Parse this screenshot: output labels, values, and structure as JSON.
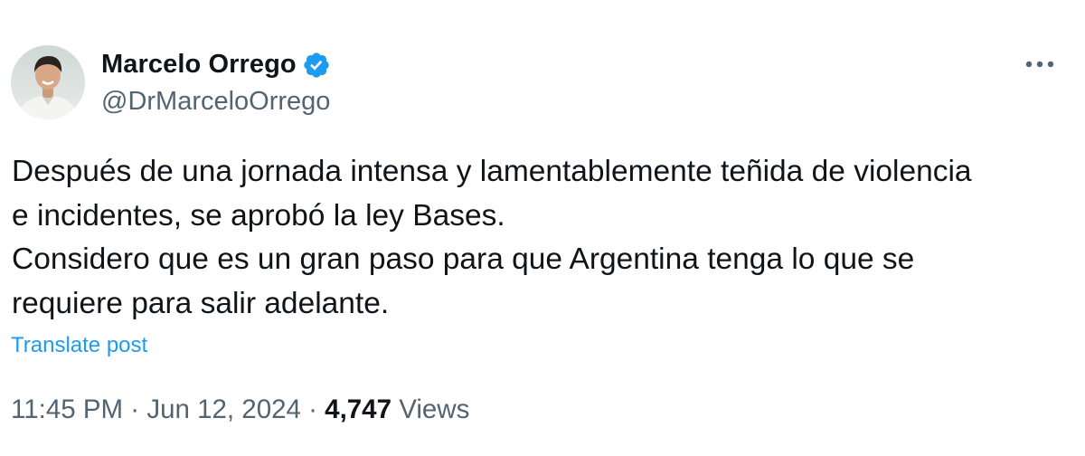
{
  "author": {
    "display_name": "Marcelo Orrego",
    "handle": "@DrMarceloOrrego",
    "verified": true
  },
  "menu": {
    "icon": "more-horizontal-icon"
  },
  "post": {
    "text": "Después de una jornada intensa y lamentablemente teñida de violencia\ne incidentes, se aprobó la ley Bases.\nConsidero que es un gran paso para que Argentina tenga lo que se\nrequiere para salir adelante."
  },
  "translate_label": "Translate post",
  "meta": {
    "time": "11:45 PM",
    "separator": "·",
    "date": "Jun 12, 2024",
    "views_count": "4,747",
    "views_label": "Views"
  },
  "colors": {
    "text_primary": "#0f1419",
    "text_secondary": "#536471",
    "accent": "#1d9bf0"
  }
}
